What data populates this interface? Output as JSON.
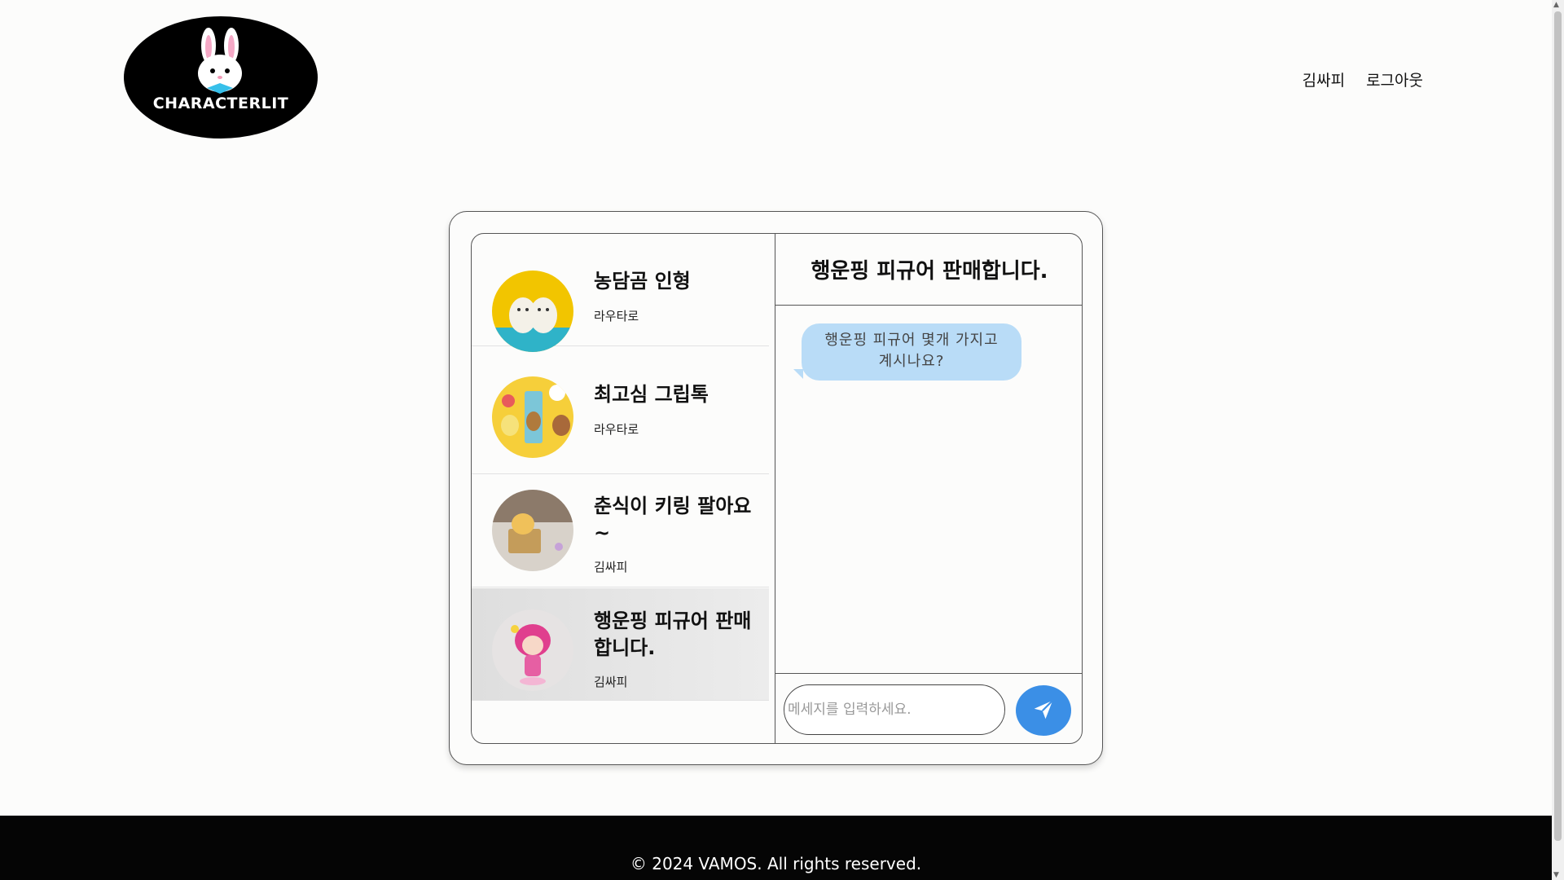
{
  "header": {
    "logo_text": "CHARACTERLIT",
    "nav": {
      "user": "김싸피",
      "logout": "로그아웃"
    }
  },
  "chat_list": [
    {
      "title": "농담곰 인형",
      "seller": "라우타로",
      "thumb": "white-bear-plush"
    },
    {
      "title": "최고심 그립톡",
      "seller": "라우타로",
      "thumb": "griptok"
    },
    {
      "title": "춘식이 키링 팔아요~",
      "seller": "김싸피",
      "thumb": "chunsik-keyring"
    },
    {
      "title": "행운핑 피규어 판매합니다.",
      "seller": "김싸피",
      "thumb": "pink-figure",
      "active": true
    }
  ],
  "conversation": {
    "title": "행운핑 피규어 판매합니다.",
    "messages": [
      {
        "text": "행운핑 피규어 몇개 가지고 계시나요?"
      }
    ],
    "input_placeholder": "메세지를 입력하세요.",
    "send_icon": "paper-plane-icon"
  },
  "footer": {
    "text": "© 2024 VAMOS. All rights reserved."
  },
  "colors": {
    "bubble": "#b9dcf7",
    "send_button": "#3b8fe6",
    "footer_bg": "#050505"
  }
}
